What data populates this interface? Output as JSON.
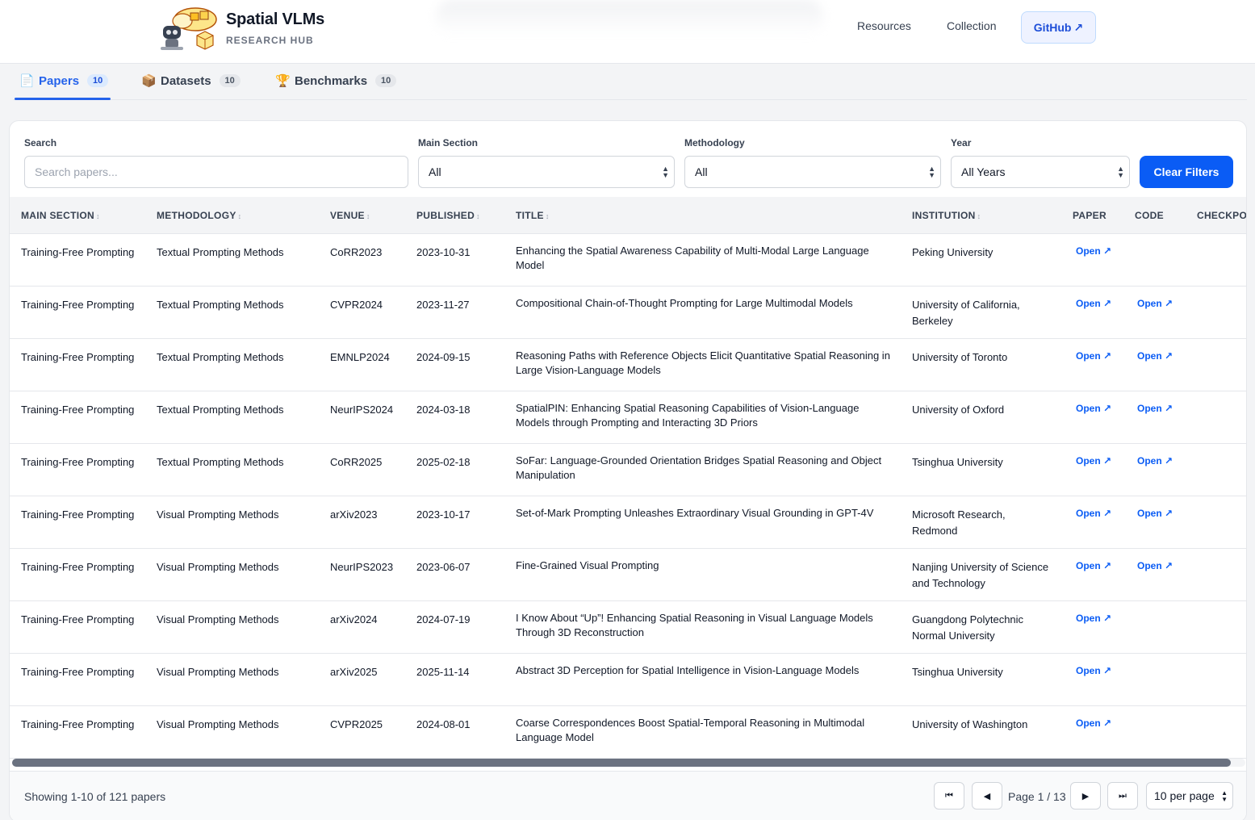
{
  "brand": {
    "title": "Spatial VLMs",
    "subtitle": "RESEARCH HUB"
  },
  "nav": {
    "resources": "Resources",
    "collection": "Collection",
    "github": "GitHub",
    "github_icon": "↗"
  },
  "tabs": [
    {
      "icon": "📄",
      "label": "Papers",
      "count": "10"
    },
    {
      "icon": "📦",
      "label": "Datasets",
      "count": "10"
    },
    {
      "icon": "🏆",
      "label": "Benchmarks",
      "count": "10"
    }
  ],
  "filters": {
    "search_label": "Search",
    "search_placeholder": "Search papers...",
    "main_section_label": "Main Section",
    "main_section_value": "All",
    "methodology_label": "Methodology",
    "methodology_value": "All",
    "year_label": "Year",
    "year_value": "All Years",
    "clear_label": "Clear Filters"
  },
  "table": {
    "columns": {
      "main_section": "MAIN SECTION",
      "methodology": "METHODOLOGY",
      "venue": "VENUE",
      "published": "PUBLISHED",
      "title": "TITLE",
      "institution": "INSTITUTION",
      "paper": "PAPER",
      "code": "CODE",
      "checkpoint": "CHECKPOI"
    },
    "sort_glyph": "↕",
    "link_label": "Open ↗",
    "rows": [
      {
        "main_section": "Training-Free Prompting",
        "methodology": "Textual Prompting Methods",
        "venue": "CoRR2023",
        "published": "2023-10-31",
        "title": "Enhancing the Spatial Awareness Capability of Multi-Modal Large Language Model",
        "institution": "Peking University",
        "paper": "Open ↗",
        "code": ""
      },
      {
        "main_section": "Training-Free Prompting",
        "methodology": "Textual Prompting Methods",
        "venue": "CVPR2024",
        "published": "2023-11-27",
        "title": "Compositional Chain-of-Thought Prompting for Large Multimodal Models",
        "institution": "University of California, Berkeley",
        "paper": "Open ↗",
        "code": "Open ↗"
      },
      {
        "main_section": "Training-Free Prompting",
        "methodology": "Textual Prompting Methods",
        "venue": "EMNLP2024",
        "published": "2024-09-15",
        "title": "Reasoning Paths with Reference Objects Elicit Quantitative Spatial Reasoning in Large Vision-Language Models",
        "institution": "University of Toronto",
        "paper": "Open ↗",
        "code": "Open ↗"
      },
      {
        "main_section": "Training-Free Prompting",
        "methodology": "Textual Prompting Methods",
        "venue": "NeurIPS2024",
        "published": "2024-03-18",
        "title": "SpatialPIN: Enhancing Spatial Reasoning Capabilities of Vision-Language Models through Prompting and Interacting 3D Priors",
        "institution": "University of Oxford",
        "paper": "Open ↗",
        "code": "Open ↗"
      },
      {
        "main_section": "Training-Free Prompting",
        "methodology": "Textual Prompting Methods",
        "venue": "CoRR2025",
        "published": "2025-02-18",
        "title": "SoFar: Language-Grounded Orientation Bridges Spatial Reasoning and Object Manipulation",
        "institution": "Tsinghua University",
        "paper": "Open ↗",
        "code": "Open ↗"
      },
      {
        "main_section": "Training-Free Prompting",
        "methodology": "Visual Prompting Methods",
        "venue": "arXiv2023",
        "published": "2023-10-17",
        "title": "Set-of-Mark Prompting Unleashes Extraordinary Visual Grounding in GPT-4V",
        "institution": "Microsoft Research, Redmond",
        "paper": "Open ↗",
        "code": "Open ↗"
      },
      {
        "main_section": "Training-Free Prompting",
        "methodology": "Visual Prompting Methods",
        "venue": "NeurIPS2023",
        "published": "2023-06-07",
        "title": "Fine-Grained Visual Prompting",
        "institution": "Nanjing University of Science and Technology",
        "paper": "Open ↗",
        "code": "Open ↗"
      },
      {
        "main_section": "Training-Free Prompting",
        "methodology": "Visual Prompting Methods",
        "venue": "arXiv2024",
        "published": "2024-07-19",
        "title": "I Know About “Up”! Enhancing Spatial Reasoning in Visual Language Models Through 3D Reconstruction",
        "institution": "Guangdong Polytechnic Normal University",
        "paper": "Open ↗",
        "code": ""
      },
      {
        "main_section": "Training-Free Prompting",
        "methodology": "Visual Prompting Methods",
        "venue": "arXiv2025",
        "published": "2025-11-14",
        "title": "Abstract 3D Perception for Spatial Intelligence in Vision-Language Models",
        "institution": "Tsinghua University",
        "paper": "Open ↗",
        "code": ""
      },
      {
        "main_section": "Training-Free Prompting",
        "methodology": "Visual Prompting Methods",
        "venue": "CVPR2025",
        "published": "2024-08-01",
        "title": "Coarse Correspondences Boost Spatial-Temporal Reasoning in Multimodal Language Model",
        "institution": "University of Washington",
        "paper": "Open ↗",
        "code": ""
      }
    ]
  },
  "footer": {
    "showing": "Showing 1-10 of 121 papers",
    "page_info": "Page 1 / 13",
    "per_page": "10 per page",
    "first_icon": "⏮",
    "prev_icon": "◀",
    "next_icon": "▶",
    "last_icon": "⏭"
  },
  "colors": {
    "accent": "#0a5cf5",
    "tab_active": "#2563eb",
    "border": "#e5e7eb"
  }
}
